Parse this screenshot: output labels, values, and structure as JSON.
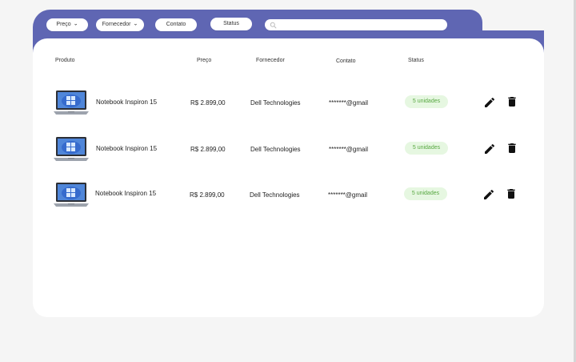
{
  "filters": {
    "price_label": "Preço",
    "supplier_label": "Fornecedor",
    "contact_label": "Contato",
    "status_label": "Status",
    "search_placeholder": ""
  },
  "table": {
    "headers": {
      "product": "Produto",
      "price": "Preço",
      "supplier": "Fornecedor",
      "contact": "Contato",
      "status": "Status"
    },
    "rows": [
      {
        "product": "Notebook Inspiron 15",
        "price": "R$ 2.899,00",
        "supplier": "Dell Technologies",
        "contact": "*******@gmail",
        "status": "5 unidades"
      },
      {
        "product": "Notebook Inspiron 15",
        "price": "R$ 2.899,00",
        "supplier": "Dell Technologies",
        "contact": "*******@gmail",
        "status": "5 unidades"
      },
      {
        "product": "Notebook Inspiron 15",
        "price": "R$ 2.899,00",
        "supplier": "Dell Technologies",
        "contact": "*******@gmail",
        "status": "5 unidades"
      }
    ]
  },
  "icons": {
    "search": "search-icon",
    "chevron": "chevron-down-icon",
    "edit": "pencil-icon",
    "delete": "trash-icon",
    "thumbnail": "laptop-thumbnail"
  },
  "colors": {
    "accent": "#5f66b3",
    "badge_bg": "#e6f7e1",
    "badge_text": "#58a842",
    "page_bg": "#f5f5f5"
  }
}
